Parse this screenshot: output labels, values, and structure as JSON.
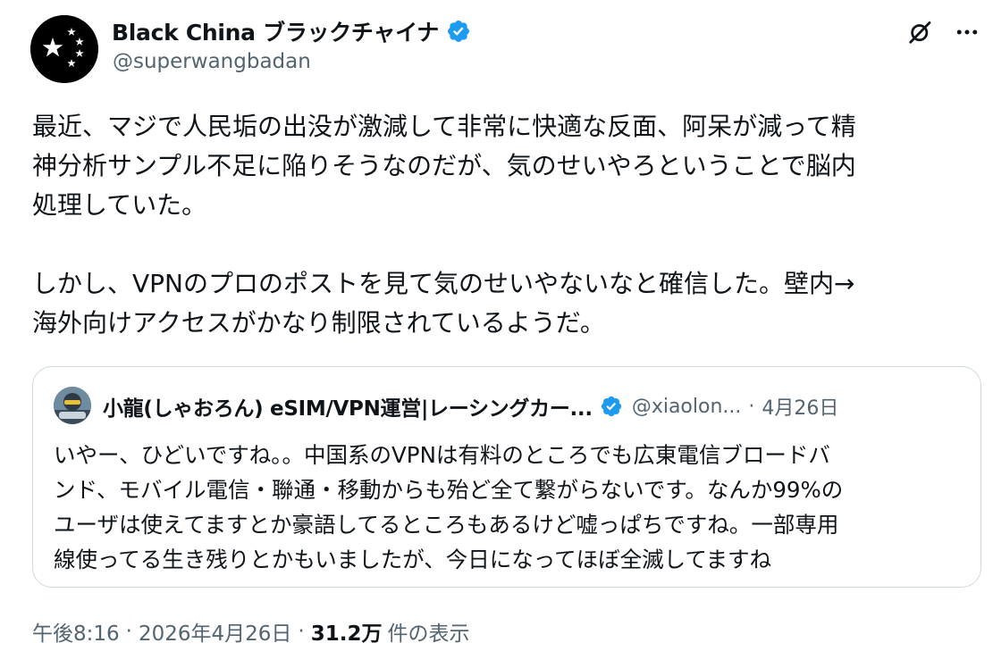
{
  "author": {
    "name": "Black China ブラックチャイナ",
    "handle": "@superwangbadan",
    "avatar_icon": "black-flag-five-stars",
    "verified_color": "#1d9bf0"
  },
  "tweet": {
    "lines": [
      "最近、マジで人民垢の出没が激減して非常に快適な反面、阿呆が減って精",
      "神分析サンプル不足に陥りそうなのだが、気のせいやろということで脳内",
      "処理していた。",
      "しかし、VPNのプロのポストを見て気のせいやないなと確信した。壁内→",
      "海外向けアクセスがかなり制限されているようだ。"
    ]
  },
  "quote": {
    "name": "小龍(しゃおろん) eSIM/VPN運営|レーシングカー...",
    "handle": "@xiaolon...",
    "separator": "·",
    "date": "4月26日",
    "lines": [
      "いやー、ひどいですね。。中国系のVPNは有料のところでも広東電信ブロードバ",
      "ンド、モバイル電信・聯通・移動からも殆ど全て繋がらないです。なんか99%の",
      "ユーザは使えてますとか豪語してるところもあるけど嘘っぱちですね。一部専用",
      "線使ってる生き残りとかもいましたが、今日になってほぼ全滅してますね"
    ]
  },
  "meta": {
    "time": "午後8:16",
    "separator": "·",
    "date": "2026年4月26日",
    "views_count": "31.2万",
    "views_label": "件の表示"
  },
  "icons": {
    "grok": "grok-icon",
    "more": "more-icon"
  }
}
